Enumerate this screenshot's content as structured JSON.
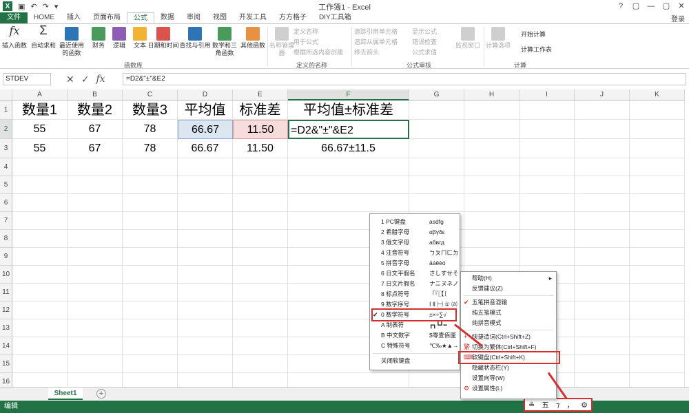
{
  "app": {
    "title": "工作簿1 - Excel",
    "login": "登录",
    "logo": "X",
    "window_controls": [
      "?",
      "▢",
      "—",
      "▢",
      "✕"
    ]
  },
  "tabs": [
    "文件",
    "HOME",
    "插入",
    "页面布局",
    "公式",
    "数据",
    "审阅",
    "视图",
    "开发工具",
    "方方格子",
    "DIY工具箱"
  ],
  "active_tab": "公式",
  "ribbon": {
    "insert_fn": "插入函数",
    "autosum": "自动求和",
    "recent": "最近使用的函数",
    "finance": "财务",
    "logic": "逻辑",
    "text": "文本",
    "datetime": "日期和时间",
    "lookup": "查找与引用",
    "math": "数学和三角函数",
    "other": "其他函数",
    "group_fn": "函数库",
    "name_mgr": "名称管理器",
    "define_name": "定义名称",
    "use_in_formula": "用于公式",
    "create_from_sel": "根据所选内容创建",
    "group_names": "定义的名称",
    "trace_prec": "追踪引用单元格",
    "trace_dep": "追踪从属单元格",
    "remove_arrows": "移去箭头",
    "show_formulas": "显示公式",
    "error_check": "错误检查",
    "eval_formula": "公式求值",
    "group_audit": "公式审核",
    "watch": "监视窗口",
    "calc_opts": "计算选项",
    "calc_now": "开始计算",
    "calc_sheet": "计算工作表",
    "group_calc": "计算"
  },
  "formula_bar": {
    "name_box": "STDEV",
    "formula": "=D2&\"±\"&E2",
    "cancel": "✕",
    "enter": "✓",
    "fx": "fx"
  },
  "grid": {
    "columns": [
      "A",
      "B",
      "C",
      "D",
      "E",
      "F",
      "G",
      "H",
      "I",
      "J",
      "K"
    ],
    "rows": [
      "1",
      "2",
      "3",
      "4",
      "5",
      "6",
      "7",
      "8",
      "9",
      "10",
      "11",
      "12",
      "13",
      "14",
      "15",
      "16"
    ],
    "header_row": [
      "数量1",
      "数量2",
      "数量3",
      "平均值",
      "标准差",
      "平均值±标准差"
    ],
    "row2": [
      "55",
      "67",
      "78",
      "66.67",
      "11.50",
      "=D2&\"±\"&E2"
    ],
    "row3": [
      "55",
      "67",
      "78",
      "66.67",
      "11.50",
      "66.67±11.5"
    ]
  },
  "sheet_tab": "Sheet1",
  "add_sheet": "+",
  "status": "编辑",
  "ime_bar": [
    "≗",
    "五",
    "⁊",
    "，",
    "⚙"
  ],
  "softkbd_menu": {
    "items": [
      {
        "label": "1 PC键盘",
        "sample": "asdfg"
      },
      {
        "label": "2 希腊字母",
        "sample": "αβγδε"
      },
      {
        "label": "3 俄文字母",
        "sample": "абвгд"
      },
      {
        "label": "4 注音符号",
        "sample": "ㄅㄆㄇㄈㄉ"
      },
      {
        "label": "5 拼音字母",
        "sample": "āáěèó"
      },
      {
        "label": "6 日文平假名",
        "sample": "さしすせそ"
      },
      {
        "label": "7 日文片假名",
        "sample": "ナニヌネノ"
      },
      {
        "label": "8 标点符号",
        "sample": "「『〖【〔"
      },
      {
        "label": "9 数字序号",
        "sample": "Ⅰ Ⅱ ㈠ ① ⒜"
      },
      {
        "label": "0 数学符号",
        "sample": "±×÷∑√",
        "checked": true
      },
      {
        "label": "A 制表符",
        "sample": "┏┓┗┛━"
      },
      {
        "label": "B 中文数字",
        "sample": "$零壹佰厘"
      },
      {
        "label": "C 特殊符号",
        "sample": "℃‰★▲→"
      }
    ],
    "close": "关闭软键盘"
  },
  "ime_menu": {
    "items": [
      {
        "label": "帮助(H)",
        "submenu": true
      },
      {
        "label": "反馈建议(Z)"
      },
      {
        "label": "五笔拼音混输",
        "checked": true
      },
      {
        "label": "纯五笔模式"
      },
      {
        "label": "纯拼音模式"
      },
      {
        "label": "快捷造词(Ctrl+Shift+Z)",
        "icon": "+"
      },
      {
        "label": "切换为繁体(Ctrl+Shift+F)",
        "icon": "繁"
      },
      {
        "label": "软键盘(Ctrl+Shift+K)",
        "icon": "⌨",
        "highlight": true
      },
      {
        "label": "隐藏状态栏(Y)"
      },
      {
        "label": "设置向导(W)"
      },
      {
        "label": "设置属性(L)",
        "icon": "⚙"
      }
    ]
  },
  "colors": {
    "excel_green": "#217346",
    "annotation_red": "#d32f2f"
  }
}
